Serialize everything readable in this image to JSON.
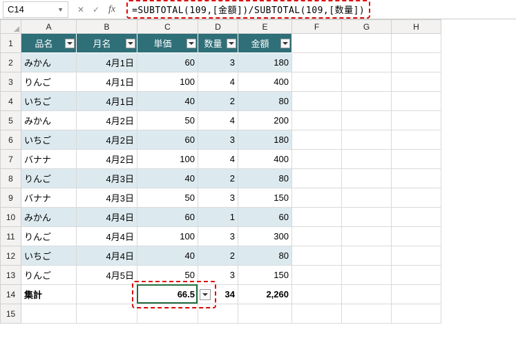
{
  "namebox": {
    "value": "C14"
  },
  "formula": "=SUBTOTAL(109,[金額])/SUBTOTAL(109,[数量])",
  "columns": [
    "A",
    "B",
    "C",
    "D",
    "E",
    "F",
    "G",
    "H"
  ],
  "headers": {
    "A": "品名",
    "B": "月名",
    "C": "単価",
    "D": "数量",
    "E": "金額"
  },
  "rows": [
    {
      "n": 2,
      "A": "みかん",
      "B": "4月1日",
      "C": 60,
      "D": 3,
      "E": 180,
      "band": "odd"
    },
    {
      "n": 3,
      "A": "りんご",
      "B": "4月1日",
      "C": 100,
      "D": 4,
      "E": 400,
      "band": "even"
    },
    {
      "n": 4,
      "A": "いちご",
      "B": "4月1日",
      "C": 40,
      "D": 2,
      "E": 80,
      "band": "odd"
    },
    {
      "n": 5,
      "A": "みかん",
      "B": "4月2日",
      "C": 50,
      "D": 4,
      "E": 200,
      "band": "even"
    },
    {
      "n": 6,
      "A": "いちご",
      "B": "4月2日",
      "C": 60,
      "D": 3,
      "E": 180,
      "band": "odd"
    },
    {
      "n": 7,
      "A": "バナナ",
      "B": "4月2日",
      "C": 100,
      "D": 4,
      "E": 400,
      "band": "even"
    },
    {
      "n": 8,
      "A": "りんご",
      "B": "4月3日",
      "C": 40,
      "D": 2,
      "E": 80,
      "band": "odd"
    },
    {
      "n": 9,
      "A": "バナナ",
      "B": "4月3日",
      "C": 50,
      "D": 3,
      "E": 150,
      "band": "even"
    },
    {
      "n": 10,
      "A": "みかん",
      "B": "4月4日",
      "C": 60,
      "D": 1,
      "E": 60,
      "band": "odd"
    },
    {
      "n": 11,
      "A": "りんご",
      "B": "4月4日",
      "C": 100,
      "D": 3,
      "E": 300,
      "band": "even"
    },
    {
      "n": 12,
      "A": "いちご",
      "B": "4月4日",
      "C": 40,
      "D": 2,
      "E": 80,
      "band": "odd"
    },
    {
      "n": 13,
      "A": "りんご",
      "B": "4月5日",
      "C": 50,
      "D": 3,
      "E": 150,
      "band": "even"
    }
  ],
  "total": {
    "label": "集計",
    "C": "66.5",
    "D": "34",
    "E": "2,260"
  },
  "chart_data": {
    "type": "table",
    "columns": [
      "品名",
      "月名",
      "単価",
      "数量",
      "金額"
    ],
    "data": [
      [
        "みかん",
        "4月1日",
        60,
        3,
        180
      ],
      [
        "りんご",
        "4月1日",
        100,
        4,
        400
      ],
      [
        "いちご",
        "4月1日",
        40,
        2,
        80
      ],
      [
        "みかん",
        "4月2日",
        50,
        4,
        200
      ],
      [
        "いちご",
        "4月2日",
        60,
        3,
        180
      ],
      [
        "バナナ",
        "4月2日",
        100,
        4,
        400
      ],
      [
        "りんご",
        "4月3日",
        40,
        2,
        80
      ],
      [
        "バナナ",
        "4月3日",
        50,
        3,
        150
      ],
      [
        "みかん",
        "4月4日",
        60,
        1,
        60
      ],
      [
        "りんご",
        "4月4日",
        100,
        3,
        300
      ],
      [
        "いちご",
        "4月4日",
        40,
        2,
        80
      ],
      [
        "りんご",
        "4月5日",
        50,
        3,
        150
      ]
    ],
    "totals": {
      "単価": 66.5,
      "数量": 34,
      "金額": 2260
    }
  }
}
